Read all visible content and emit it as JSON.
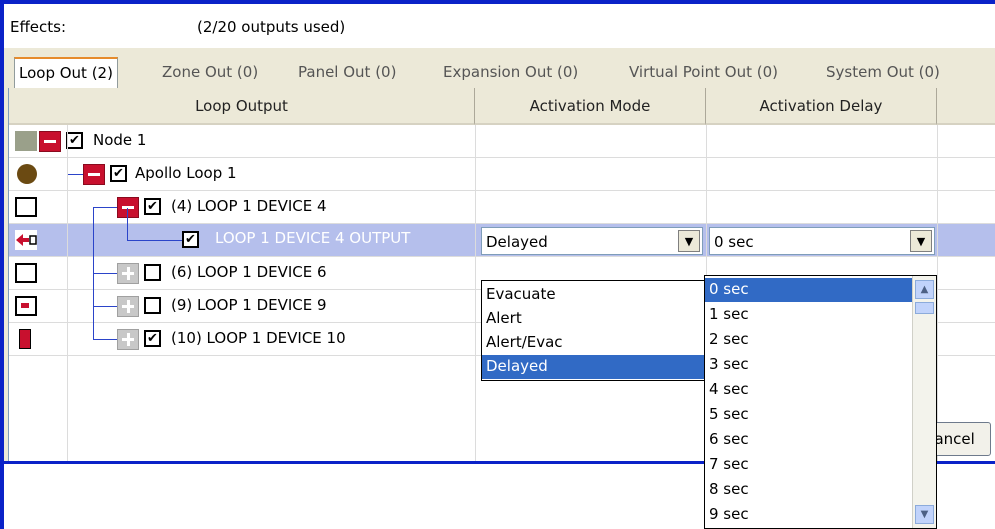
{
  "header": {
    "label": "Effects:",
    "count": "(2/20 outputs used)"
  },
  "tabs": [
    {
      "label": "Loop Out (2)",
      "active": true
    },
    {
      "label": "Zone Out (0)"
    },
    {
      "label": "Panel Out (0)"
    },
    {
      "label": "Expansion Out (0)"
    },
    {
      "label": "Virtual Point Out (0)"
    },
    {
      "label": "System Out (0)"
    }
  ],
  "columns": {
    "output": "Loop Output",
    "mode": "Activation Mode",
    "delay": "Activation Delay"
  },
  "rows": [
    {
      "label": "Node 1",
      "checked": "☑",
      "icon": "node-icon"
    },
    {
      "label": "Apollo Loop 1",
      "checked": "☑",
      "icon": "loop-icon"
    },
    {
      "label": "(4) LOOP 1 DEVICE 4",
      "checked": "☑",
      "icon": "device-icon"
    },
    {
      "label": "LOOP 1 DEVICE 4 OUTPUT",
      "checked": "☑",
      "icon": "output-arrow-icon"
    },
    {
      "label": "(6) LOOP 1 DEVICE 6",
      "checked": "",
      "icon": "device-icon"
    },
    {
      "label": "(9) LOOP 1 DEVICE 9",
      "checked": "",
      "icon": "device-alarm-icon"
    },
    {
      "label": "(10) LOOP 1 DEVICE 10",
      "checked": "☑",
      "icon": "sounder-icon"
    }
  ],
  "check_mark": "✔",
  "mode_combo": {
    "value": "Delayed",
    "arrow": "▼"
  },
  "delay_combo": {
    "value": "0 sec",
    "arrow": "▼"
  },
  "mode_options": [
    "Evacuate",
    "Alert",
    "Alert/Evac",
    "Delayed"
  ],
  "mode_selected_index": 3,
  "delay_options": [
    "0 sec",
    "1 sec",
    "2 sec",
    "3 sec",
    "4 sec",
    "5 sec",
    "6 sec",
    "7 sec",
    "8 sec",
    "9 sec"
  ],
  "delay_selected_index": 0,
  "scroll": {
    "up": "▲",
    "down": "▼"
  },
  "cancel_button": "Cancel",
  "colors": {
    "selection": "#316ac5",
    "row_selected": "#b5bfec",
    "tree_line": "#2b44c9",
    "collapse_box": "#c8102e"
  }
}
